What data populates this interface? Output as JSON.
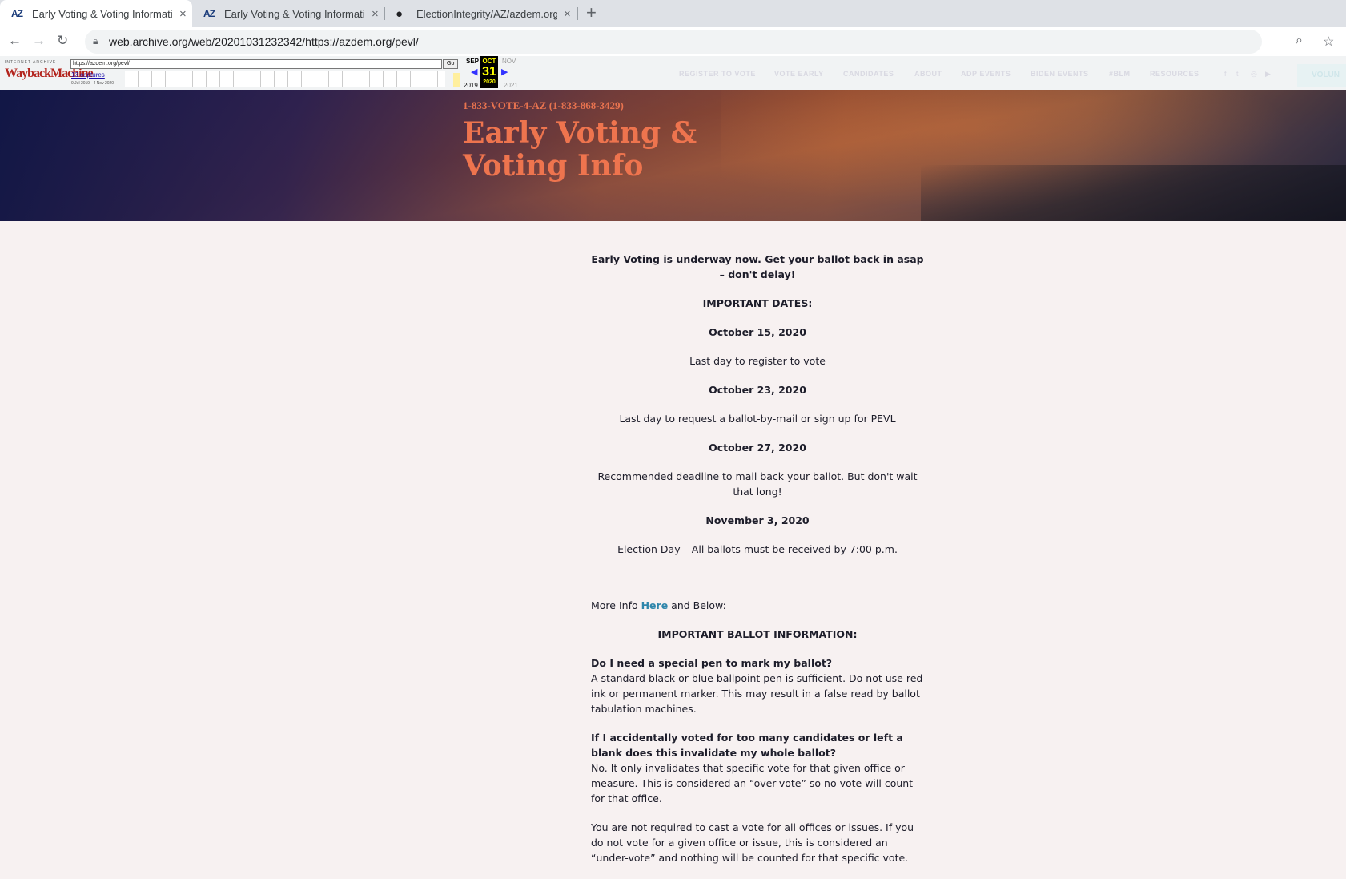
{
  "tabs": [
    {
      "favicon": "AZ",
      "title": "Early Voting & Voting Informatio",
      "close": "×"
    },
    {
      "favicon": "AZ",
      "title": "Early Voting & Voting Informatio",
      "close": "×"
    },
    {
      "favicon": "github-icon",
      "title": "ElectionIntegrity/AZ/azdem.org a",
      "close": "×"
    }
  ],
  "new_tab": "+",
  "address_bar": {
    "url": "web.archive.org/web/20201031232342/https://azdem.org/pevl/"
  },
  "wayback": {
    "logo_top": "INTERNET ARCHIVE",
    "logo_main": "WaybackMachine",
    "url_field": "https://azdem.org/pevl/",
    "go": "Go",
    "captures": "13 captures",
    "range": "9 Jul 2019 - 4 Nov 2020",
    "prev_month": "SEP",
    "cur_month": "OCT",
    "next_month": "NOV",
    "prev_year": "2019",
    "cur_day": "31",
    "cur_year": "2020",
    "next_year": "2021"
  },
  "site_nav": [
    "REGISTER TO VOTE",
    "VOTE EARLY",
    "CANDIDATES",
    "ABOUT",
    "ADP EVENTS",
    "BIDEN EVENTS",
    "#BLM",
    "RESOURCES"
  ],
  "site_nav_cta": "VOLUN",
  "hero": {
    "phone": "1-833-VOTE-4-AZ (1-833-868-3429)",
    "title": "Early Voting & Voting Info"
  },
  "content": {
    "intro": "Early Voting is underway now. Get your ballot back in asap – don't delay!",
    "dates_heading": "IMPORTANT DATES:",
    "dates": [
      {
        "date": "October 15, 2020",
        "desc": "Last day to register to vote"
      },
      {
        "date": "October 23, 2020",
        "desc": "Last day to request a ballot-by-mail or sign up for PEVL"
      },
      {
        "date": "October 27, 2020",
        "desc": "Recommended deadline to mail back your ballot. But don't wait that long!"
      },
      {
        "date": "November 3, 2020",
        "desc": "Election Day – All ballots must be received by 7:00 p.m."
      }
    ],
    "more_info_prefix": "More Info ",
    "more_info_link": "Here",
    "more_info_suffix": " and Below:",
    "ballot_heading": "IMPORTANT BALLOT INFORMATION:",
    "faq": [
      {
        "q": "Do I need a special pen to mark my ballot?",
        "a": "A standard black or blue ballpoint pen is sufficient. Do not use red ink or permanent marker. This may result in a false read by ballot tabulation machines."
      },
      {
        "q": "If I accidentally voted for too many candidates or left a blank does this invalidate my whole ballot?",
        "a": "No. It only invalidates that specific vote for that given office or measure. This is considered an “over-vote” so no vote will count for that office."
      }
    ],
    "under_vote": "You are not required to cast a vote for all offices or issues. If you do not vote for a given office or issue, this is considered an “under-vote” and nothing will be counted for that specific vote."
  }
}
